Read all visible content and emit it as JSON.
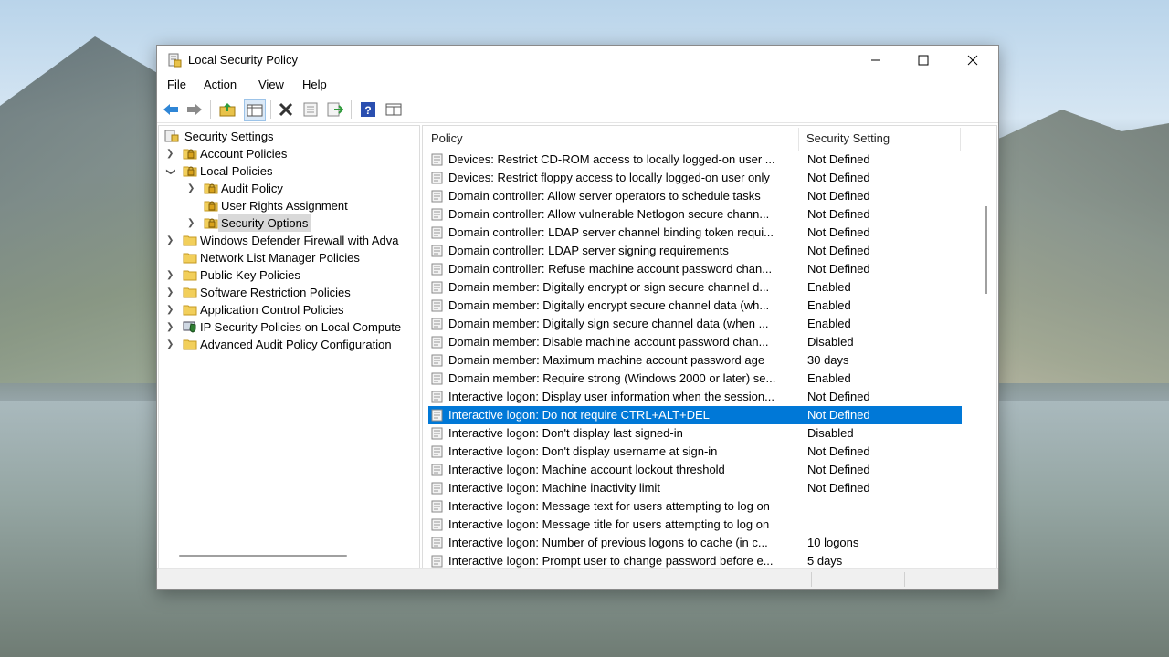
{
  "window": {
    "title": "Local Security Policy",
    "controls": {
      "minimize": "minimize",
      "maximize": "maximize",
      "close": "close"
    }
  },
  "menu": [
    "File",
    "Action",
    "View",
    "Help"
  ],
  "toolbar_icons": [
    "back-icon",
    "forward-icon",
    "up-folder-icon",
    "show-hide-tree-icon",
    "delete-icon",
    "properties-icon",
    "export-list-icon",
    "help-icon",
    "console-icon"
  ],
  "tree": {
    "root": "Security Settings",
    "items": [
      {
        "label": "Account Policies",
        "level": 1,
        "expand": "collapsed",
        "icon": "lock-folder-icon"
      },
      {
        "label": "Local Policies",
        "level": 1,
        "expand": "expanded",
        "icon": "lock-folder-icon"
      },
      {
        "label": "Audit Policy",
        "level": 2,
        "expand": "collapsed",
        "icon": "lock-folder-icon"
      },
      {
        "label": "User Rights Assignment",
        "level": 2,
        "expand": "none",
        "icon": "lock-folder-icon"
      },
      {
        "label": "Security Options",
        "level": 2,
        "expand": "collapsed",
        "icon": "lock-folder-icon",
        "selected": true
      },
      {
        "label": "Windows Defender Firewall with Adva",
        "level": 1,
        "expand": "collapsed",
        "icon": "folder-icon"
      },
      {
        "label": "Network List Manager Policies",
        "level": 1,
        "expand": "none",
        "icon": "folder-icon"
      },
      {
        "label": "Public Key Policies",
        "level": 1,
        "expand": "collapsed",
        "icon": "folder-icon"
      },
      {
        "label": "Software Restriction Policies",
        "level": 1,
        "expand": "collapsed",
        "icon": "folder-icon"
      },
      {
        "label": "Application Control Policies",
        "level": 1,
        "expand": "collapsed",
        "icon": "folder-icon"
      },
      {
        "label": "IP Security Policies on Local Compute",
        "level": 1,
        "expand": "collapsed",
        "icon": "shield-computer-icon"
      },
      {
        "label": "Advanced Audit Policy Configuration",
        "level": 1,
        "expand": "collapsed",
        "icon": "folder-icon"
      }
    ]
  },
  "list": {
    "columns": [
      "Policy",
      "Security Setting"
    ],
    "rows": [
      {
        "policy": "Devices: Restrict CD-ROM access to locally logged-on user ...",
        "setting": "Not Defined"
      },
      {
        "policy": "Devices: Restrict floppy access to locally logged-on user only",
        "setting": "Not Defined"
      },
      {
        "policy": "Domain controller: Allow server operators to schedule tasks",
        "setting": "Not Defined"
      },
      {
        "policy": "Domain controller: Allow vulnerable Netlogon secure chann...",
        "setting": "Not Defined"
      },
      {
        "policy": "Domain controller: LDAP server channel binding token requi...",
        "setting": "Not Defined"
      },
      {
        "policy": "Domain controller: LDAP server signing requirements",
        "setting": "Not Defined"
      },
      {
        "policy": "Domain controller: Refuse machine account password chan...",
        "setting": "Not Defined"
      },
      {
        "policy": "Domain member: Digitally encrypt or sign secure channel d...",
        "setting": "Enabled"
      },
      {
        "policy": "Domain member: Digitally encrypt secure channel data (wh...",
        "setting": "Enabled"
      },
      {
        "policy": "Domain member: Digitally sign secure channel data (when ...",
        "setting": "Enabled"
      },
      {
        "policy": "Domain member: Disable machine account password chan...",
        "setting": "Disabled"
      },
      {
        "policy": "Domain member: Maximum machine account password age",
        "setting": "30 days"
      },
      {
        "policy": "Domain member: Require strong (Windows 2000 or later) se...",
        "setting": "Enabled"
      },
      {
        "policy": "Interactive logon: Display user information when the session...",
        "setting": "Not Defined"
      },
      {
        "policy": "Interactive logon: Do not require CTRL+ALT+DEL",
        "setting": "Not Defined",
        "selected": true
      },
      {
        "policy": "Interactive logon: Don't display last signed-in",
        "setting": "Disabled"
      },
      {
        "policy": "Interactive logon: Don't display username at sign-in",
        "setting": "Not Defined"
      },
      {
        "policy": "Interactive logon: Machine account lockout threshold",
        "setting": "Not Defined"
      },
      {
        "policy": "Interactive logon: Machine inactivity limit",
        "setting": "Not Defined"
      },
      {
        "policy": "Interactive logon: Message text for users attempting to log on",
        "setting": ""
      },
      {
        "policy": "Interactive logon: Message title for users attempting to log on",
        "setting": ""
      },
      {
        "policy": "Interactive logon: Number of previous logons to cache (in c...",
        "setting": "10 logons"
      },
      {
        "policy": "Interactive logon: Prompt user to change password before e...",
        "setting": "5 days"
      }
    ]
  },
  "colors": {
    "selection": "#0078d7",
    "tree_selection": "#d9d9d9"
  }
}
